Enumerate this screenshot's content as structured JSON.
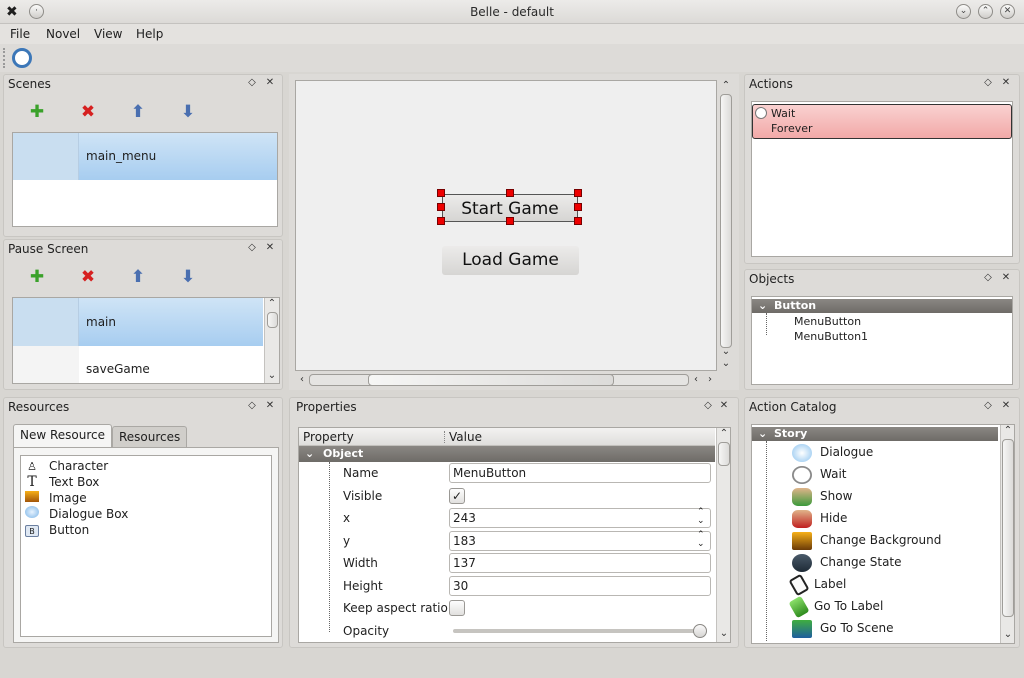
{
  "window": {
    "title": "Belle - default"
  },
  "menu": [
    "File",
    "Novel",
    "View",
    "Help"
  ],
  "scenes": {
    "title": "Scenes",
    "items": [
      "main_menu"
    ]
  },
  "pause_screen": {
    "title": "Pause Screen",
    "items": [
      "main",
      "saveGame"
    ]
  },
  "canvas": {
    "buttons": [
      "Start Game",
      "Load Game"
    ]
  },
  "actions": {
    "title": "Actions",
    "item": {
      "name": "Wait",
      "detail": "Forever"
    }
  },
  "objects": {
    "title": "Objects",
    "group": "Button",
    "items": [
      "MenuButton",
      "MenuButton1"
    ]
  },
  "resources": {
    "title": "Resources",
    "tabs": [
      "New Resource",
      "Resources"
    ],
    "items": [
      {
        "label": "Character",
        "icon": "character-icon"
      },
      {
        "label": "Text Box",
        "icon": "text-box-icon"
      },
      {
        "label": "Image",
        "icon": "image-icon"
      },
      {
        "label": "Dialogue Box",
        "icon": "dialogue-box-icon"
      },
      {
        "label": "Button",
        "icon": "button-icon"
      }
    ]
  },
  "properties": {
    "title": "Properties",
    "headers": [
      "Property",
      "Value"
    ],
    "group": "Object",
    "rows": [
      {
        "name": "Name",
        "value": "MenuButton",
        "kind": "text"
      },
      {
        "name": "Visible",
        "value": "checked",
        "kind": "checkbox"
      },
      {
        "name": "x",
        "value": "243",
        "kind": "spin"
      },
      {
        "name": "y",
        "value": "183",
        "kind": "spin"
      },
      {
        "name": "Width",
        "value": "137",
        "kind": "text"
      },
      {
        "name": "Height",
        "value": "30",
        "kind": "text"
      },
      {
        "name": "Keep aspect ratio",
        "value": "unchecked",
        "kind": "checkbox"
      },
      {
        "name": "Opacity",
        "value": 1.0,
        "kind": "slider"
      }
    ]
  },
  "action_catalog": {
    "title": "Action Catalog",
    "group": "Story",
    "items": [
      {
        "label": "Dialogue",
        "icon": "dialogue-icon"
      },
      {
        "label": "Wait",
        "icon": "stopwatch-icon"
      },
      {
        "label": "Show",
        "icon": "show-icon"
      },
      {
        "label": "Hide",
        "icon": "hide-icon"
      },
      {
        "label": "Change Background",
        "icon": "background-icon"
      },
      {
        "label": "Change State",
        "icon": "state-icon"
      },
      {
        "label": "Label",
        "icon": "tag-icon"
      },
      {
        "label": "Go To Label",
        "icon": "goto-label-icon"
      },
      {
        "label": "Go To Scene",
        "icon": "clapper-icon"
      }
    ]
  },
  "colors": {
    "accent": "#a7cdf0",
    "action_selected": "#f7b9b8",
    "handle": "#e00000",
    "add": "#3aa12a",
    "remove": "#d62020"
  }
}
